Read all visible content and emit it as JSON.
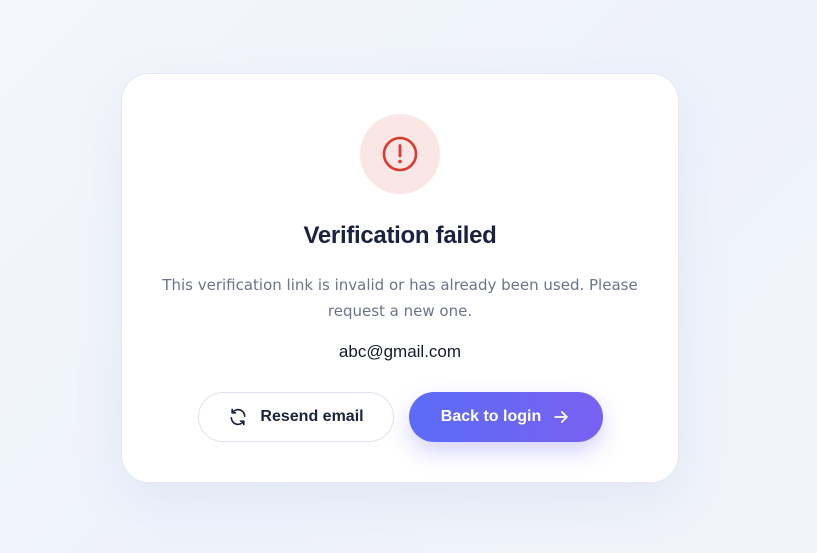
{
  "card": {
    "icon": "alert-circle-icon",
    "title": "Verification failed",
    "message": "This verification link is invalid or has already been used. Please request a new one.",
    "email": "abc@gmail.com"
  },
  "actions": {
    "resend_label": "Resend email",
    "resend_icon": "refresh-icon",
    "login_label": "Back to login",
    "login_icon": "arrow-right-icon"
  },
  "colors": {
    "accent_start": "#5b6cf6",
    "accent_end": "#7a60f2",
    "error": "#d93a2b",
    "error_bg": "#fbe6e6",
    "title": "#1a2240"
  }
}
